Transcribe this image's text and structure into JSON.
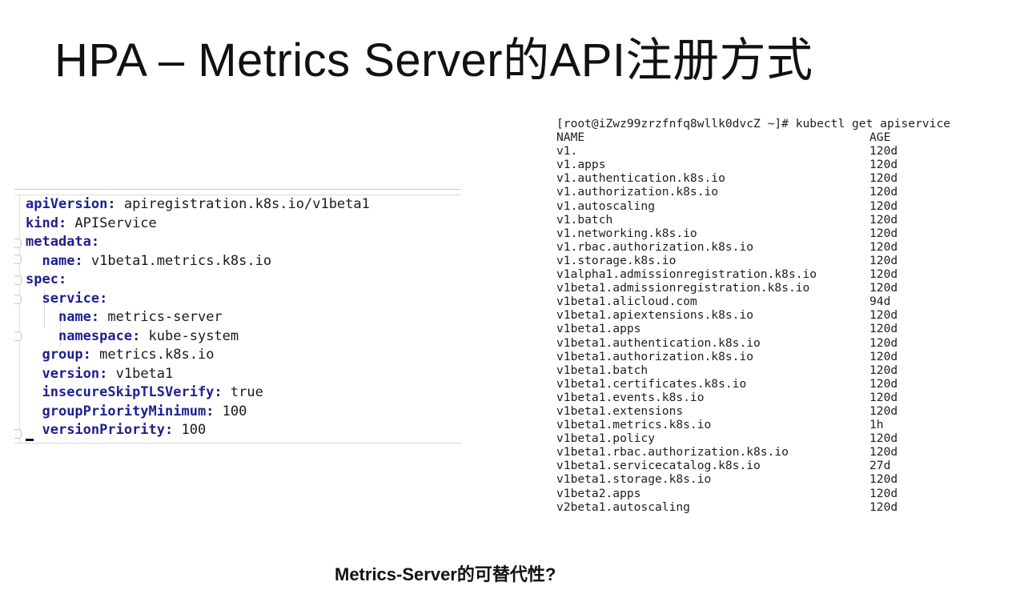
{
  "title": "HPA – Metrics Server的API注册方式",
  "yaml": {
    "lines": [
      {
        "key": "apiVersion:",
        "value": " apiregistration.k8s.io/v1beta1",
        "indent": ""
      },
      {
        "key": "kind:",
        "value": " APIService",
        "indent": ""
      },
      {
        "key": "metadata:",
        "value": "",
        "indent": ""
      },
      {
        "key": "name:",
        "value": " v1beta1.metrics.k8s.io",
        "indent": "  "
      },
      {
        "key": "spec:",
        "value": "",
        "indent": ""
      },
      {
        "key": "service:",
        "value": "",
        "indent": "  "
      },
      {
        "key": "name:",
        "value": " metrics-server",
        "indent": "    "
      },
      {
        "key": "namespace:",
        "value": " kube-system",
        "indent": "    "
      },
      {
        "key": "group:",
        "value": " metrics.k8s.io",
        "indent": "  "
      },
      {
        "key": "version:",
        "value": " v1beta1",
        "indent": "  "
      },
      {
        "key": "insecureSkipTLSVerify:",
        "value": " true",
        "indent": "  "
      },
      {
        "key": "groupPriorityMinimum:",
        "value": " 100",
        "indent": "  "
      },
      {
        "key": "versionPriority:",
        "value": " 100",
        "indent": "  "
      }
    ]
  },
  "terminal": {
    "prompt": "[root@iZwz99zrzfnfq8wllk0dvcZ ~]# kubectl get apiservice",
    "headers": [
      "NAME",
      "AGE"
    ],
    "rows": [
      [
        "v1.",
        "120d"
      ],
      [
        "v1.apps",
        "120d"
      ],
      [
        "v1.authentication.k8s.io",
        "120d"
      ],
      [
        "v1.authorization.k8s.io",
        "120d"
      ],
      [
        "v1.autoscaling",
        "120d"
      ],
      [
        "v1.batch",
        "120d"
      ],
      [
        "v1.networking.k8s.io",
        "120d"
      ],
      [
        "v1.rbac.authorization.k8s.io",
        "120d"
      ],
      [
        "v1.storage.k8s.io",
        "120d"
      ],
      [
        "v1alpha1.admissionregistration.k8s.io",
        "120d"
      ],
      [
        "v1beta1.admissionregistration.k8s.io",
        "120d"
      ],
      [
        "v1beta1.alicloud.com",
        "94d"
      ],
      [
        "v1beta1.apiextensions.k8s.io",
        "120d"
      ],
      [
        "v1beta1.apps",
        "120d"
      ],
      [
        "v1beta1.authentication.k8s.io",
        "120d"
      ],
      [
        "v1beta1.authorization.k8s.io",
        "120d"
      ],
      [
        "v1beta1.batch",
        "120d"
      ],
      [
        "v1beta1.certificates.k8s.io",
        "120d"
      ],
      [
        "v1beta1.events.k8s.io",
        "120d"
      ],
      [
        "v1beta1.extensions",
        "120d"
      ],
      [
        "v1beta1.metrics.k8s.io",
        "1h"
      ],
      [
        "v1beta1.policy",
        "120d"
      ],
      [
        "v1beta1.rbac.authorization.k8s.io",
        "120d"
      ],
      [
        "v1beta1.servicecatalog.k8s.io",
        "27d"
      ],
      [
        "v1beta1.storage.k8s.io",
        "120d"
      ],
      [
        "v1beta2.apps",
        "120d"
      ],
      [
        "v2beta1.autoscaling",
        "120d"
      ]
    ]
  },
  "subtitle": "Metrics-Server的可替代性?"
}
